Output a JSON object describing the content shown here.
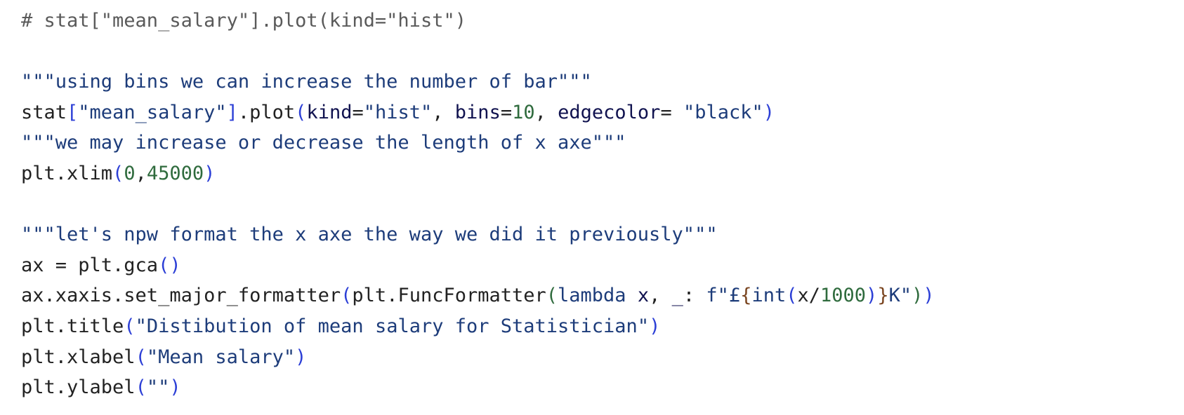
{
  "code_lines": [
    [
      {
        "text": "# stat[\"mean_salary\"].plot(kind=\"hist\")",
        "kind": "comment"
      }
    ],
    [],
    [
      {
        "text": "\"\"\"using bins we can increase the number of bar\"\"\"",
        "kind": "string"
      }
    ],
    [
      {
        "text": "stat",
        "kind": "plain"
      },
      {
        "text": "[",
        "kind": "paren"
      },
      {
        "text": "\"mean_salary\"",
        "kind": "string"
      },
      {
        "text": "]",
        "kind": "paren"
      },
      {
        "text": ".plot",
        "kind": "plain"
      },
      {
        "text": "(",
        "kind": "paren"
      },
      {
        "text": "kind",
        "kind": "kwarg"
      },
      {
        "text": "=",
        "kind": "plain"
      },
      {
        "text": "\"hist\"",
        "kind": "string"
      },
      {
        "text": ", ",
        "kind": "plain"
      },
      {
        "text": "bins",
        "kind": "kwarg"
      },
      {
        "text": "=",
        "kind": "plain"
      },
      {
        "text": "10",
        "kind": "number"
      },
      {
        "text": ", ",
        "kind": "plain"
      },
      {
        "text": "edgecolor",
        "kind": "kwarg"
      },
      {
        "text": "= ",
        "kind": "plain"
      },
      {
        "text": "\"black\"",
        "kind": "string"
      },
      {
        "text": ")",
        "kind": "paren"
      }
    ],
    [
      {
        "text": "\"\"\"we may increase or decrease the length of x axe\"\"\"",
        "kind": "string"
      }
    ],
    [
      {
        "text": "plt.xlim",
        "kind": "plain"
      },
      {
        "text": "(",
        "kind": "paren"
      },
      {
        "text": "0",
        "kind": "number"
      },
      {
        "text": ",",
        "kind": "plain"
      },
      {
        "text": "45000",
        "kind": "number"
      },
      {
        "text": ")",
        "kind": "paren"
      }
    ],
    [],
    [
      {
        "text": "\"\"\"let's npw format the x axe the way we did it previously\"\"\"",
        "kind": "string"
      }
    ],
    [
      {
        "text": "ax = plt.gca",
        "kind": "plain"
      },
      {
        "text": "()",
        "kind": "paren"
      }
    ],
    [
      {
        "text": "ax.xaxis.set_major_formatter",
        "kind": "plain"
      },
      {
        "text": "(",
        "kind": "paren"
      },
      {
        "text": "plt.FuncFormatter",
        "kind": "plain"
      },
      {
        "text": "(",
        "kind": "green"
      },
      {
        "text": "lambda",
        "kind": "string"
      },
      {
        "text": " ",
        "kind": "plain"
      },
      {
        "text": "x",
        "kind": "kwarg"
      },
      {
        "text": ", ",
        "kind": "plain"
      },
      {
        "text": "_",
        "kind": "kwarg"
      },
      {
        "text": ": ",
        "kind": "plain"
      },
      {
        "text": "f\"£",
        "kind": "string"
      },
      {
        "text": "{",
        "kind": "brown"
      },
      {
        "text": "int",
        "kind": "string"
      },
      {
        "text": "(",
        "kind": "paren"
      },
      {
        "text": "x/",
        "kind": "plain"
      },
      {
        "text": "1000",
        "kind": "number"
      },
      {
        "text": ")",
        "kind": "paren"
      },
      {
        "text": "}",
        "kind": "brown"
      },
      {
        "text": "K\"",
        "kind": "string"
      },
      {
        "text": ")",
        "kind": "green"
      },
      {
        "text": ")",
        "kind": "paren"
      }
    ],
    [
      {
        "text": "plt.title",
        "kind": "plain"
      },
      {
        "text": "(",
        "kind": "paren"
      },
      {
        "text": "\"Distibution of mean salary for Statistician\"",
        "kind": "string"
      },
      {
        "text": ")",
        "kind": "paren"
      }
    ],
    [
      {
        "text": "plt.xlabel",
        "kind": "plain"
      },
      {
        "text": "(",
        "kind": "paren"
      },
      {
        "text": "\"Mean salary\"",
        "kind": "string"
      },
      {
        "text": ")",
        "kind": "paren"
      }
    ],
    [
      {
        "text": "plt.ylabel",
        "kind": "plain"
      },
      {
        "text": "(",
        "kind": "paren"
      },
      {
        "text": "\"\"",
        "kind": "string"
      },
      {
        "text": ")",
        "kind": "paren"
      }
    ]
  ],
  "colors": {
    "plain": "#222222",
    "comment": "#5a5a5a",
    "string": "#1d3c7a",
    "paren": "#2c3fd6",
    "number": "#2f6b3d",
    "kwarg": "#10124f",
    "green": "#2f6b3d",
    "brown": "#7a4520"
  }
}
